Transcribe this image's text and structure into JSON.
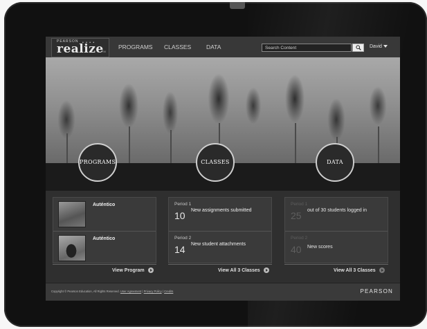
{
  "header": {
    "logo_small": "PEARSON",
    "logo_main": "realize",
    "logo_tm": "TM",
    "nav": [
      "PROGRAMS",
      "CLASSES",
      "DATA"
    ],
    "search_placeholder": "Search Content",
    "user": "David"
  },
  "hero": {
    "circles": [
      "PROGRAMS",
      "CLASSES",
      "DATA"
    ]
  },
  "programs": {
    "items": [
      {
        "title": "Auténtico"
      },
      {
        "title": "Auténtico"
      }
    ],
    "link": "View Program"
  },
  "classes": {
    "items": [
      {
        "period": "Period 1",
        "count": "10",
        "text": "New assignments submitted"
      },
      {
        "period": "Period 2",
        "count": "14",
        "text": "New student attachments"
      }
    ],
    "link": "View All 3 Classes"
  },
  "data": {
    "items": [
      {
        "period": "Period 1",
        "count": "25",
        "text": "out of 30 students logged in"
      },
      {
        "period": "Period 2",
        "count": "40",
        "text": "New scores"
      }
    ],
    "link": "View All 3 Classes"
  },
  "footer": {
    "copyright": "Copyright © Pearson Education, All Rights Reserved.",
    "links": [
      "User Agreement",
      "Privacy Policy",
      "Credits"
    ],
    "brand": "PEARSON"
  }
}
